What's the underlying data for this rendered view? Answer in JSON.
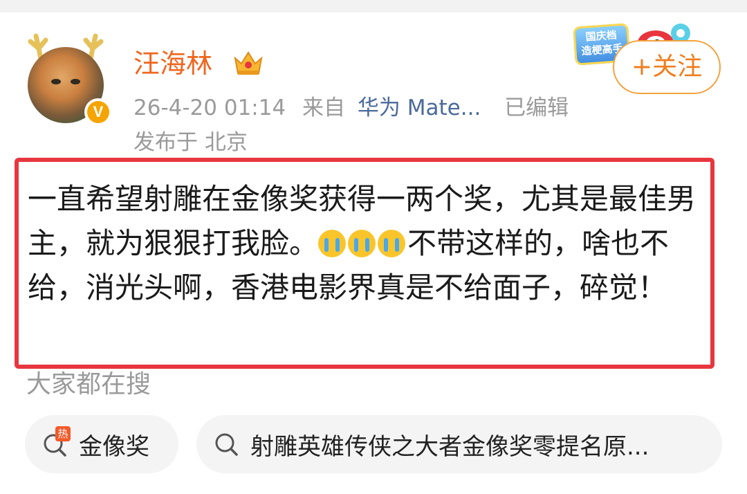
{
  "profile": {
    "name": "汪海林",
    "timestamp": "26-4-20 01:14",
    "from_label": "来自",
    "source": "华为 Mate...",
    "edited": "已编辑",
    "location": "发布于 北京"
  },
  "promo_badge": {
    "line1": "国庆档",
    "line2": "造梗高手"
  },
  "follow_button": "+关注",
  "post": {
    "text_before_emoji": "一直希望射雕在金像奖获得一两个奖，尤其是最佳男主，就为狠狠打我脸。",
    "emoji": [
      "crying-emoji",
      "crying-emoji",
      "crying-emoji"
    ],
    "text_after_emoji": "不带这样的，啥也不给，消光头啊，香港电影界真是不给面子，碎觉！"
  },
  "search_section": {
    "title": "大家都在搜",
    "chips": [
      {
        "label": "金像奖",
        "icon": "hot-search-icon"
      },
      {
        "label": "射雕英雄传侠之大者金像奖零提名原...",
        "icon": "search-icon"
      }
    ]
  },
  "colors": {
    "username": "#f0651e",
    "follow_border": "#f2a23c",
    "highlight_border": "#e8363f",
    "source_link": "#4a6a9a",
    "meta_gray": "#9a9a9a"
  }
}
